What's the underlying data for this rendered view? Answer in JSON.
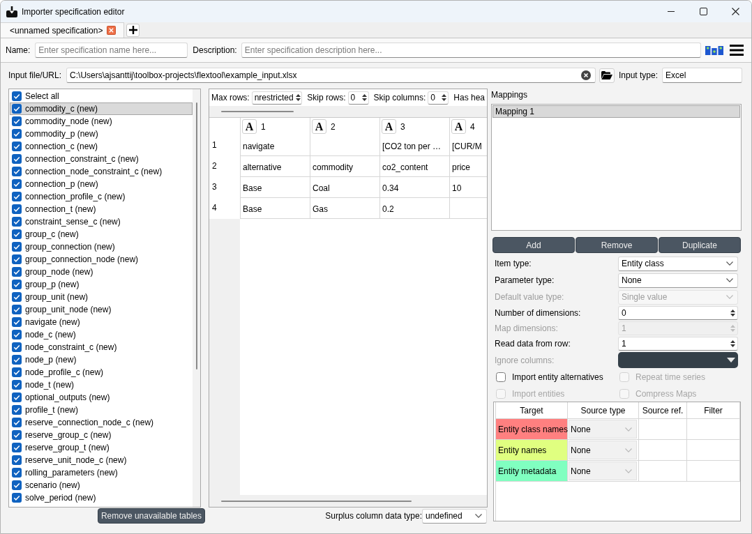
{
  "window": {
    "title": "Importer specification editor"
  },
  "tabs": [
    {
      "label": "<unnamed specification>",
      "selected": true
    }
  ],
  "specification": {
    "name": {
      "label": "Name:",
      "placeholder": "Enter specification name here..."
    },
    "description": {
      "label": "Description:",
      "placeholder": "Enter specification description here..."
    }
  },
  "source": {
    "label": "Input file/URL:",
    "value": "C:\\Users\\ajsanttij\\toolbox-projects\\flextool\\example_input.xlsx",
    "input_type": {
      "label": "Input type:",
      "value": "Excel"
    }
  },
  "source_tables": {
    "select_all": {
      "label": "Select all",
      "checked": true
    },
    "items": [
      {
        "label": "commodity_c (new)",
        "checked": true,
        "selected": true
      },
      {
        "label": "commodity_node (new)",
        "checked": true,
        "selected": false
      },
      {
        "label": "commodity_p (new)",
        "checked": true,
        "selected": false
      },
      {
        "label": "connection_c (new)",
        "checked": true,
        "selected": false
      },
      {
        "label": "connection_constraint_c (new)",
        "checked": true,
        "selected": false
      },
      {
        "label": "connection_node_constraint_c (new)",
        "checked": true,
        "selected": false
      },
      {
        "label": "connection_p (new)",
        "checked": true,
        "selected": false
      },
      {
        "label": "connection_profile_c (new)",
        "checked": true,
        "selected": false
      },
      {
        "label": "connection_t (new)",
        "checked": true,
        "selected": false
      },
      {
        "label": "constraint_sense_c (new)",
        "checked": true,
        "selected": false
      },
      {
        "label": "group_c (new)",
        "checked": true,
        "selected": false
      },
      {
        "label": "group_connection (new)",
        "checked": true,
        "selected": false
      },
      {
        "label": "group_connection_node (new)",
        "checked": true,
        "selected": false
      },
      {
        "label": "group_node (new)",
        "checked": true,
        "selected": false
      },
      {
        "label": "group_p (new)",
        "checked": true,
        "selected": false
      },
      {
        "label": "group_unit (new)",
        "checked": true,
        "selected": false
      },
      {
        "label": "group_unit_node (new)",
        "checked": true,
        "selected": false
      },
      {
        "label": "navigate (new)",
        "checked": true,
        "selected": false
      },
      {
        "label": "node_c (new)",
        "checked": true,
        "selected": false
      },
      {
        "label": "node_constraint_c (new)",
        "checked": true,
        "selected": false
      },
      {
        "label": "node_p (new)",
        "checked": true,
        "selected": false
      },
      {
        "label": "node_profile_c (new)",
        "checked": true,
        "selected": false
      },
      {
        "label": "node_t (new)",
        "checked": true,
        "selected": false
      },
      {
        "label": "optional_outputs (new)",
        "checked": true,
        "selected": false
      },
      {
        "label": "profile_t (new)",
        "checked": true,
        "selected": false
      },
      {
        "label": "reserve_connection_node_c (new)",
        "checked": true,
        "selected": false
      },
      {
        "label": "reserve_group_c (new)",
        "checked": true,
        "selected": false
      },
      {
        "label": "reserve_group_t (new)",
        "checked": true,
        "selected": false
      },
      {
        "label": "reserve_unit_node_c (new)",
        "checked": true,
        "selected": false
      },
      {
        "label": "rolling_parameters (new)",
        "checked": true,
        "selected": false
      },
      {
        "label": "scenario (new)",
        "checked": true,
        "selected": false
      },
      {
        "label": "solve_period (new)",
        "checked": true,
        "selected": false
      }
    ],
    "button": "Remove unavailable tables"
  },
  "preview": {
    "options": [
      {
        "kind": "spin",
        "label": "Max rows:",
        "value": "nrestricted"
      },
      {
        "kind": "spin",
        "label": "Skip rows:",
        "value": "0"
      },
      {
        "kind": "spin",
        "label": "Skip columns:",
        "value": "0"
      },
      {
        "kind": "label",
        "label": "Has hea"
      }
    ],
    "columns": [
      {
        "type_button": "A",
        "label": "1"
      },
      {
        "type_button": "A",
        "label": "2"
      },
      {
        "type_button": "A",
        "label": "3"
      },
      {
        "type_button": "A",
        "label": "4"
      }
    ],
    "rows": [
      {
        "label": "1",
        "cells": [
          "navigate",
          null,
          "[CO2 ton per …",
          "[CUR/M"
        ]
      },
      {
        "label": "2",
        "cells": [
          "alternative",
          "commodity",
          "co2_content",
          "price"
        ]
      },
      {
        "label": "3",
        "cells": [
          "Base",
          "Coal",
          "0.34",
          "10"
        ]
      },
      {
        "label": "4",
        "cells": [
          "Base",
          "Gas",
          "0.2",
          null
        ]
      }
    ],
    "surplus": {
      "label": "Surplus column data type:",
      "value": "undefined"
    }
  },
  "mappings": {
    "title": "Mappings",
    "items": [
      {
        "label": "Mapping 1",
        "selected": true
      }
    ],
    "buttons": [
      "Add",
      "Remove",
      "Duplicate"
    ]
  },
  "mapping_options": [
    {
      "kind": "select",
      "label": "Item type:",
      "value": "Entity class",
      "disabled": false
    },
    {
      "kind": "select",
      "label": "Parameter type:",
      "value": "None",
      "disabled": false
    },
    {
      "kind": "select",
      "label": "Default value type:",
      "value": "Single value",
      "disabled": true
    },
    {
      "kind": "spin",
      "label": "Number of dimensions:",
      "value": "0",
      "disabled": false
    },
    {
      "kind": "spin",
      "label": "Map dimensions:",
      "value": "1",
      "disabled": true
    },
    {
      "kind": "spin",
      "label": "Read data from row:",
      "value": "1",
      "disabled": false
    },
    {
      "kind": "chooser",
      "label": "Ignore columns:",
      "disabled": true
    }
  ],
  "mapping_flags": [
    {
      "label": "Import entity alternatives",
      "checked": false,
      "disabled": false
    },
    {
      "label": "Repeat time series",
      "checked": false,
      "disabled": true
    },
    {
      "label": "Import entities",
      "checked": false,
      "disabled": true
    },
    {
      "label": "Compress Maps",
      "checked": false,
      "disabled": true
    }
  ],
  "mapping_table": {
    "columns": [
      "Target",
      "Source type",
      "Source ref.",
      "Filter"
    ],
    "rows": [
      {
        "target": "Entity class names",
        "color": "#ff8080",
        "source_type": "None"
      },
      {
        "target": "Entity names",
        "color": "#e0ff80",
        "source_type": "None"
      },
      {
        "target": "Entity metadata",
        "color": "#80ffc0",
        "source_type": "None"
      }
    ]
  }
}
